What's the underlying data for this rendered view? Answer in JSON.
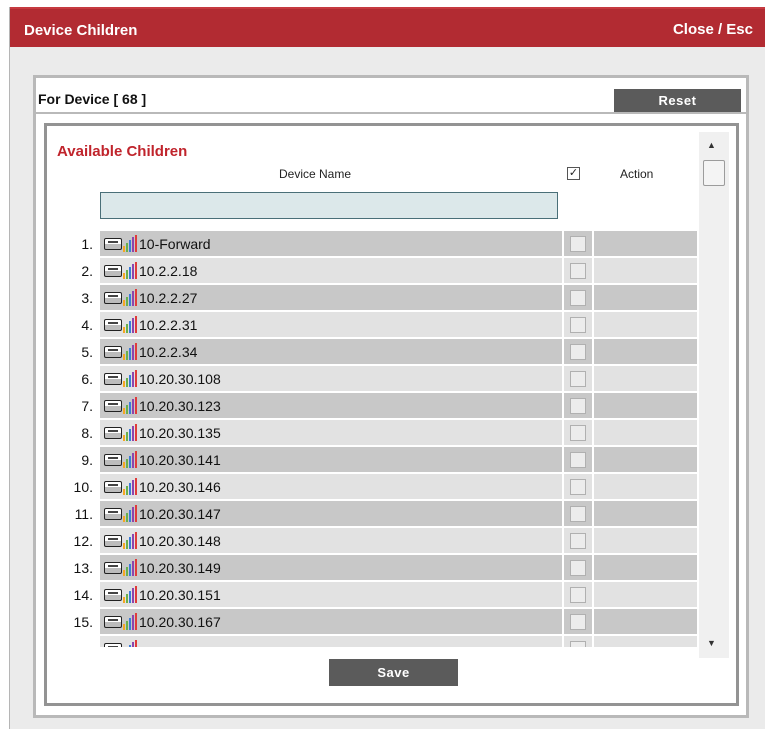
{
  "window": {
    "title": "Device Children",
    "close_label": "Close / Esc"
  },
  "device": {
    "label": "For Device [ 68 ]",
    "reset_label": "Reset"
  },
  "children": {
    "section_title": "Available Children",
    "columns": {
      "name": "Device Name",
      "check": "✓",
      "action": "Action"
    },
    "filter_value": "",
    "rows": [
      {
        "num": "1.",
        "name": "10-Forward"
      },
      {
        "num": "2.",
        "name": "10.2.2.18"
      },
      {
        "num": "3.",
        "name": "10.2.2.27"
      },
      {
        "num": "4.",
        "name": "10.2.2.31"
      },
      {
        "num": "5.",
        "name": "10.2.2.34"
      },
      {
        "num": "6.",
        "name": "10.20.30.108"
      },
      {
        "num": "7.",
        "name": "10.20.30.123"
      },
      {
        "num": "8.",
        "name": "10.20.30.135"
      },
      {
        "num": "9.",
        "name": "10.20.30.141"
      },
      {
        "num": "10.",
        "name": "10.20.30.146"
      },
      {
        "num": "11.",
        "name": "10.20.30.147"
      },
      {
        "num": "12.",
        "name": "10.20.30.148"
      },
      {
        "num": "13.",
        "name": "10.20.30.149"
      },
      {
        "num": "14.",
        "name": "10.20.30.151"
      },
      {
        "num": "15.",
        "name": "10.20.30.167"
      },
      {
        "num": "",
        "name": ""
      }
    ],
    "save_label": "Save",
    "scroll_up_glyph": "▲",
    "scroll_down_glyph": "▼"
  },
  "icons": {
    "device": "device-icon",
    "signal": "signal-strength-icon",
    "signal_colors": [
      "#f5a623",
      "#6ab04c",
      "#3b7dd8",
      "#8e44ad",
      "#e03b3b"
    ]
  },
  "colors": {
    "title_bar": "#b22b32",
    "section_title": "#c0242c",
    "button": "#5b5b5b",
    "row_odd": "#c8c8c8",
    "row_even": "#e2e2e2"
  }
}
